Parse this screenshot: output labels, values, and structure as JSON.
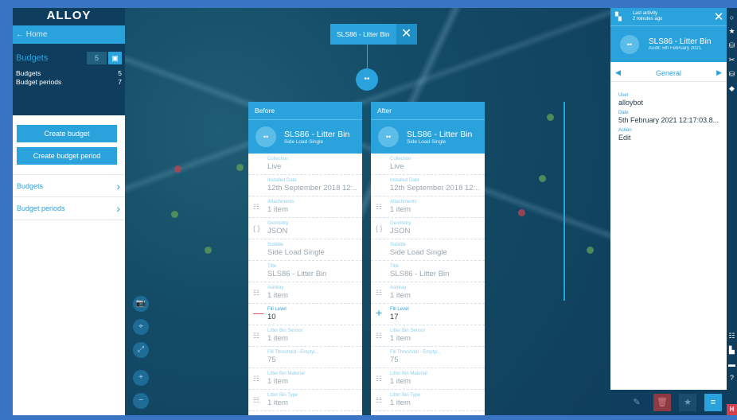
{
  "sidebar": {
    "logo": "ALLOY",
    "home_label": "← Home",
    "panel_title": "Budgets",
    "panel_count": "5",
    "panel_icon": "clipboard-icon",
    "stats": [
      {
        "label": "Budgets",
        "value": "5"
      },
      {
        "label": "Budget periods",
        "value": "7"
      }
    ],
    "create_budget": "Create budget",
    "create_period": "Create budget period",
    "links": [
      {
        "label": "Budgets",
        "chevron": "›"
      },
      {
        "label": "Budget periods",
        "chevron": "›"
      }
    ]
  },
  "map": {
    "tag_label": "SLS86 - Litter Bin",
    "tag_close": "✕",
    "pin_glyph": "••",
    "controls": [
      "📷",
      "⌖",
      "⤢",
      "+",
      "−"
    ]
  },
  "before": {
    "header": "Before",
    "item_name": "SLS86 - Litter Bin",
    "item_sub": "Side Load Single",
    "avatar": "••",
    "fields": [
      {
        "icon": "",
        "label": "Collection",
        "value": "Live"
      },
      {
        "icon": "",
        "label": "Installed Date",
        "value": "12th September 2018 12:..."
      },
      {
        "icon": "☷",
        "label": "Attachments",
        "value": "1 item"
      },
      {
        "icon": "{ }",
        "label": "Geometry",
        "value": "JSON"
      },
      {
        "icon": "",
        "label": "Subtitle",
        "value": "Side Load Single"
      },
      {
        "icon": "",
        "label": "Title",
        "value": "SLS86 - Litter Bin"
      },
      {
        "icon": "☷",
        "label": "Ashtray",
        "value": "1 item"
      },
      {
        "icon": "—",
        "label": "Fill Level",
        "value": "10"
      },
      {
        "icon": "☷",
        "label": "Litter Bin Sensor",
        "value": "1 item"
      },
      {
        "icon": "",
        "label": "Fill Threshold - Emptyi...",
        "value": "75"
      },
      {
        "icon": "☷",
        "label": "Litter Bin Material",
        "value": "1 item"
      },
      {
        "icon": "☷",
        "label": "Litter Bin Type",
        "value": "1 item"
      }
    ]
  },
  "after": {
    "header": "After",
    "item_name": "SLS86 - Litter Bin",
    "item_sub": "Side Load Single",
    "avatar": "••",
    "fields": [
      {
        "icon": "",
        "label": "Collection",
        "value": "Live"
      },
      {
        "icon": "",
        "label": "Installed Date",
        "value": "12th September 2018 12:..."
      },
      {
        "icon": "☷",
        "label": "Attachments",
        "value": "1 item"
      },
      {
        "icon": "{ }",
        "label": "Geometry",
        "value": "JSON"
      },
      {
        "icon": "",
        "label": "Subtitle",
        "value": "Side Load Single"
      },
      {
        "icon": "",
        "label": "Title",
        "value": "SLS86 - Litter Bin"
      },
      {
        "icon": "☷",
        "label": "Ashtray",
        "value": "1 item"
      },
      {
        "icon": "+",
        "label": "Fill Level",
        "value": "17"
      },
      {
        "icon": "☷",
        "label": "Litter Bin Sensor",
        "value": "1 item"
      },
      {
        "icon": "",
        "label": "Fill Threshold - Emptyi...",
        "value": "75"
      },
      {
        "icon": "☷",
        "label": "Litter Bin Material",
        "value": "1 item"
      },
      {
        "icon": "☷",
        "label": "Litter Bin Type",
        "value": "1 item"
      }
    ]
  },
  "audit": {
    "activity_label": "Last activity",
    "activity_time": "2 minutes ago",
    "close": "✕",
    "avatar": "••",
    "item_name": "SLS86 - Litter Bin",
    "item_sub": "Audit: 5th February 2021",
    "tab_label": "General",
    "tab_prev": "◀",
    "tab_next": "▶",
    "details": [
      {
        "label": "User",
        "value": "alloybot"
      },
      {
        "label": "Date",
        "value": "5th February 2021 12:17:03.8..."
      },
      {
        "label": "Action",
        "value": "Edit"
      }
    ],
    "footer": {
      "edit": "✎",
      "delete": "🗑",
      "star": "★",
      "menu": "≡"
    }
  },
  "strip": {
    "icons": [
      "○",
      "★",
      "⛁",
      "✂",
      "⛁",
      "◆"
    ],
    "bottom_icons": [
      "☷",
      "▙",
      "▬",
      "?"
    ],
    "help_label": "H"
  }
}
